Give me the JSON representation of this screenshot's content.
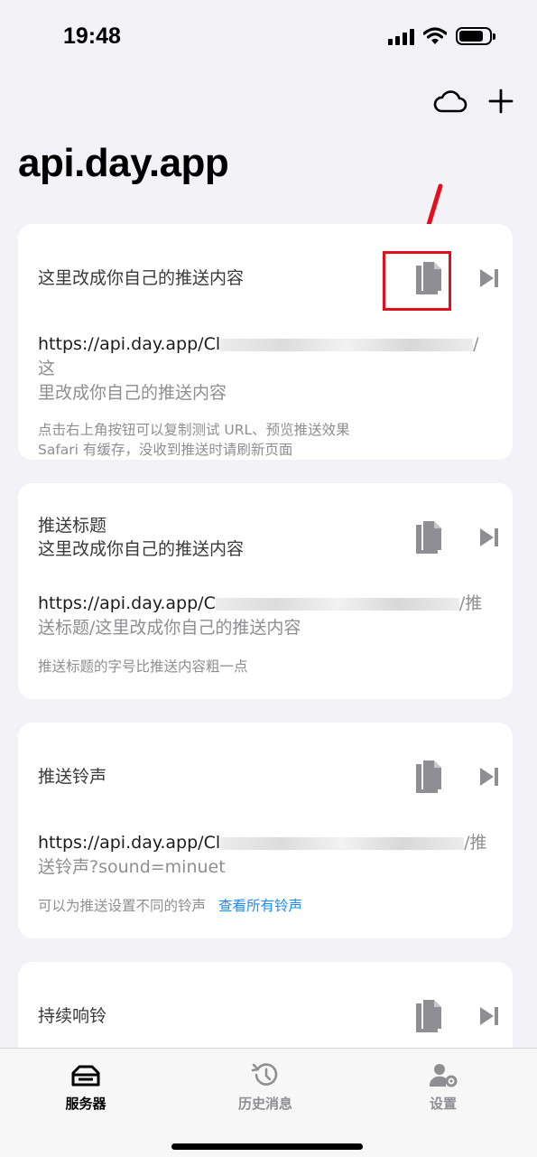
{
  "status_bar": {
    "time": "19:48"
  },
  "header": {
    "title": "api.day.app",
    "cloud_icon": "cloud-icon",
    "add_icon": "plus-icon"
  },
  "cards": [
    {
      "title": "这里改成你自己的推送内容",
      "url_prefix": "https://api.day.app/Cl",
      "url_suffix": "/这",
      "url_path": "里改成你自己的推送内容",
      "hint_lines": [
        "点击右上角按钮可以复制测试 URL、预览推送效果",
        "Safari 有缓存，没收到推送时请刷新页面"
      ],
      "highlighted": true
    },
    {
      "title": "推送标题\n这里改成你自己的推送内容",
      "url_prefix": "https://api.day.app/C",
      "url_suffix": "/推",
      "url_path": "送标题/这里改成你自己的推送内容",
      "hint_lines": [
        "推送标题的字号比推送内容粗一点"
      ]
    },
    {
      "title": "推送铃声",
      "url_prefix": "https://api.day.app/Cl",
      "url_suffix": "/推",
      "url_path": "送铃声?sound=minuet",
      "hint_lines": [
        "可以为推送设置不同的铃声"
      ],
      "hint_link": "查看所有铃声"
    },
    {
      "title": "持续响铃"
    }
  ],
  "tab_bar": {
    "tabs": [
      {
        "label": "服务器",
        "icon": "server-icon",
        "active": true
      },
      {
        "label": "历史消息",
        "icon": "history-icon",
        "active": false
      },
      {
        "label": "设置",
        "icon": "settings-icon",
        "active": false
      }
    ]
  },
  "colors": {
    "accent": "#1a8cff",
    "highlight": "#e3101c",
    "icon_gray": "#8e8e93",
    "background": "#f2f2f7"
  }
}
